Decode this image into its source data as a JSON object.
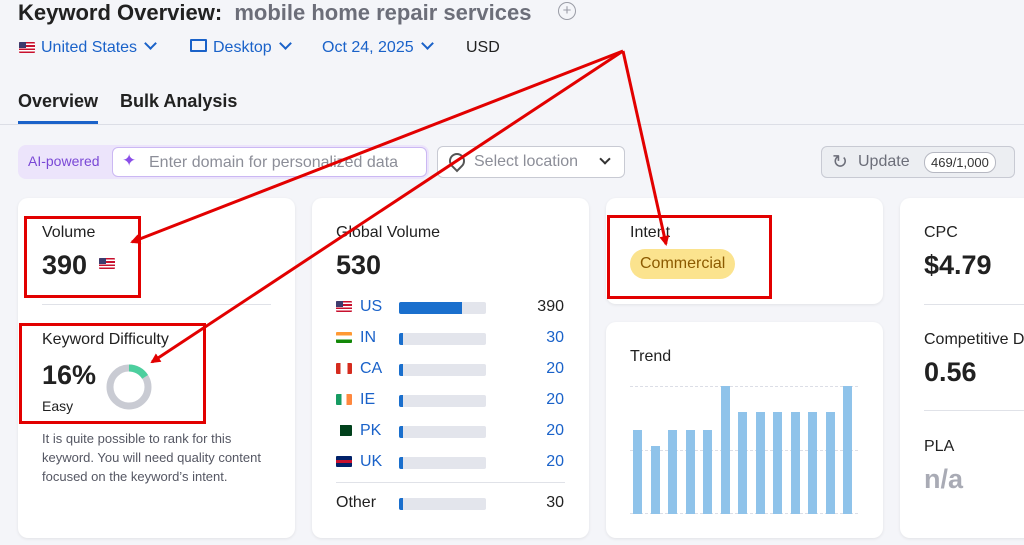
{
  "header": {
    "title_prefix": "Keyword Overview:",
    "keyword": "mobile home repair services",
    "country": "United States",
    "device": "Desktop",
    "date": "Oct 24, 2025",
    "currency": "USD"
  },
  "tabs": [
    {
      "label": "Overview",
      "active": true
    },
    {
      "label": "Bulk Analysis",
      "active": false
    }
  ],
  "toolbar": {
    "ai_badge": "AI-powered",
    "domain_placeholder": "Enter domain for personalized data",
    "location_placeholder": "Select location",
    "update_label": "Update",
    "update_count": "469/1,000"
  },
  "volume": {
    "label": "Volume",
    "value": "390"
  },
  "difficulty": {
    "label": "Keyword Difficulty",
    "value": "16%",
    "level": "Easy",
    "percent": 16,
    "description": "It is quite possible to rank for this keyword. You will need quality content focused on the keyword’s intent."
  },
  "global_volume": {
    "label": "Global Volume",
    "value": "530",
    "countries": [
      {
        "code": "US",
        "value": "390",
        "share": 0.72
      },
      {
        "code": "IN",
        "value": "30",
        "share": 0.05
      },
      {
        "code": "CA",
        "value": "20",
        "share": 0.04
      },
      {
        "code": "IE",
        "value": "20",
        "share": 0.04
      },
      {
        "code": "PK",
        "value": "20",
        "share": 0.04
      },
      {
        "code": "UK",
        "value": "20",
        "share": 0.04
      }
    ],
    "other": {
      "label": "Other",
      "value": "30",
      "share": 0.05
    }
  },
  "intent": {
    "label": "Intent",
    "badge": "Commercial"
  },
  "trend": {
    "label": "Trend",
    "values": [
      0.66,
      0.53,
      0.66,
      0.66,
      0.66,
      1.0,
      0.8,
      0.8,
      0.8,
      0.8,
      0.8,
      0.8,
      1.0
    ]
  },
  "cpc": {
    "label": "CPC",
    "value": "$4.79"
  },
  "competitive_density": {
    "label": "Competitive D",
    "value": "0.56"
  },
  "pla": {
    "label": "PLA",
    "value": "n/a"
  },
  "colors": {
    "accent": "#1a62c9",
    "annotation": "#e20000",
    "intent_badge": "#fbe38e",
    "trend_bar": "#8fc3ea"
  }
}
